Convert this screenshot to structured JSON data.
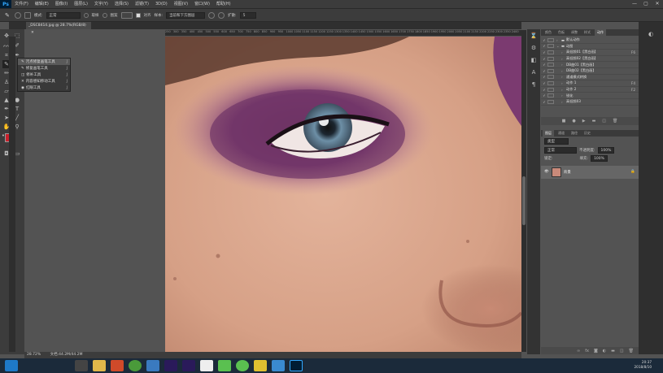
{
  "app": {
    "logo": "Ps",
    "window_controls": [
      "—",
      "▢",
      "✕"
    ]
  },
  "menubar": {
    "items": [
      "文件(F)",
      "编辑(E)",
      "图像(I)",
      "图层(L)",
      "文字(Y)",
      "选择(S)",
      "滤镜(T)",
      "3D(D)",
      "视图(V)",
      "窗口(W)",
      "帮助(H)"
    ]
  },
  "options": {
    "mode_label": "模式:",
    "mode_value": "正常",
    "opt1": "取样",
    "opt2": "图案",
    "align_label": "对齐",
    "sample_label": "样本:",
    "sample_value": "当前和下方图层",
    "spread_label": "扩散:",
    "spread_value": "5"
  },
  "document": {
    "tab_label": "_DSC8414.jpg @ 28.7%(RGB/8)",
    "tab_close": "✕"
  },
  "ruler_ticks": [
    "250",
    "300",
    "350",
    "400",
    "450",
    "500",
    "550",
    "600",
    "650",
    "700",
    "750",
    "800",
    "850",
    "900",
    "950",
    "1000",
    "1050",
    "1100",
    "1150",
    "1200",
    "1250",
    "1300",
    "1350",
    "1400",
    "1450",
    "1500",
    "1550",
    "1600",
    "1650",
    "1700",
    "1750",
    "1800",
    "1850",
    "1900",
    "1950",
    "2000",
    "2050",
    "2100",
    "2150",
    "2200",
    "2250",
    "2300",
    "2350",
    "2400"
  ],
  "flyout": {
    "items": [
      {
        "label": "污点修复画笔工具",
        "key": "J"
      },
      {
        "label": "修复画笔工具",
        "key": "J"
      },
      {
        "label": "修补工具",
        "key": "J"
      },
      {
        "label": "内容感知移动工具",
        "key": "J"
      },
      {
        "label": "红眼工具",
        "key": "J"
      }
    ]
  },
  "status": {
    "zoom": "28.72%",
    "doc_info": "文档:44.2M/44.2M"
  },
  "actions_panel": {
    "tabs": [
      "颜色",
      "色板",
      "调整",
      "样式",
      "动作"
    ],
    "rows": [
      {
        "label": "默认动作",
        "key": ""
      },
      {
        "label": "动图",
        "key": ""
      },
      {
        "label": "高低频01【黑白画】",
        "key": "F6"
      },
      {
        "label": "高低频02【黑白画】",
        "key": ""
      },
      {
        "label": "DB曲01【黑白画】",
        "key": ""
      },
      {
        "label": "DB曲02【黑白画】",
        "key": ""
      },
      {
        "label": "通道模式转换",
        "key": ""
      },
      {
        "label": "动作 1",
        "key": "F4"
      },
      {
        "label": "动作 2",
        "key": "F2"
      },
      {
        "label": "锐化",
        "key": ""
      },
      {
        "label": "高低频03",
        "key": ""
      }
    ]
  },
  "layers_panel": {
    "tabs": [
      "图层",
      "通道",
      "路径",
      "历史"
    ],
    "kind_label": "类型",
    "blend_mode": "正常",
    "opacity_label": "不透明度:",
    "opacity_value": "100%",
    "lock_label": "锁定:",
    "fill_label": "填充:",
    "fill_value": "100%",
    "layer_name": "背景"
  },
  "taskbar": {
    "time": "20:37",
    "date": "2018/8/10"
  },
  "colors": {
    "foreground": "#c8202c",
    "background": "#111111"
  }
}
